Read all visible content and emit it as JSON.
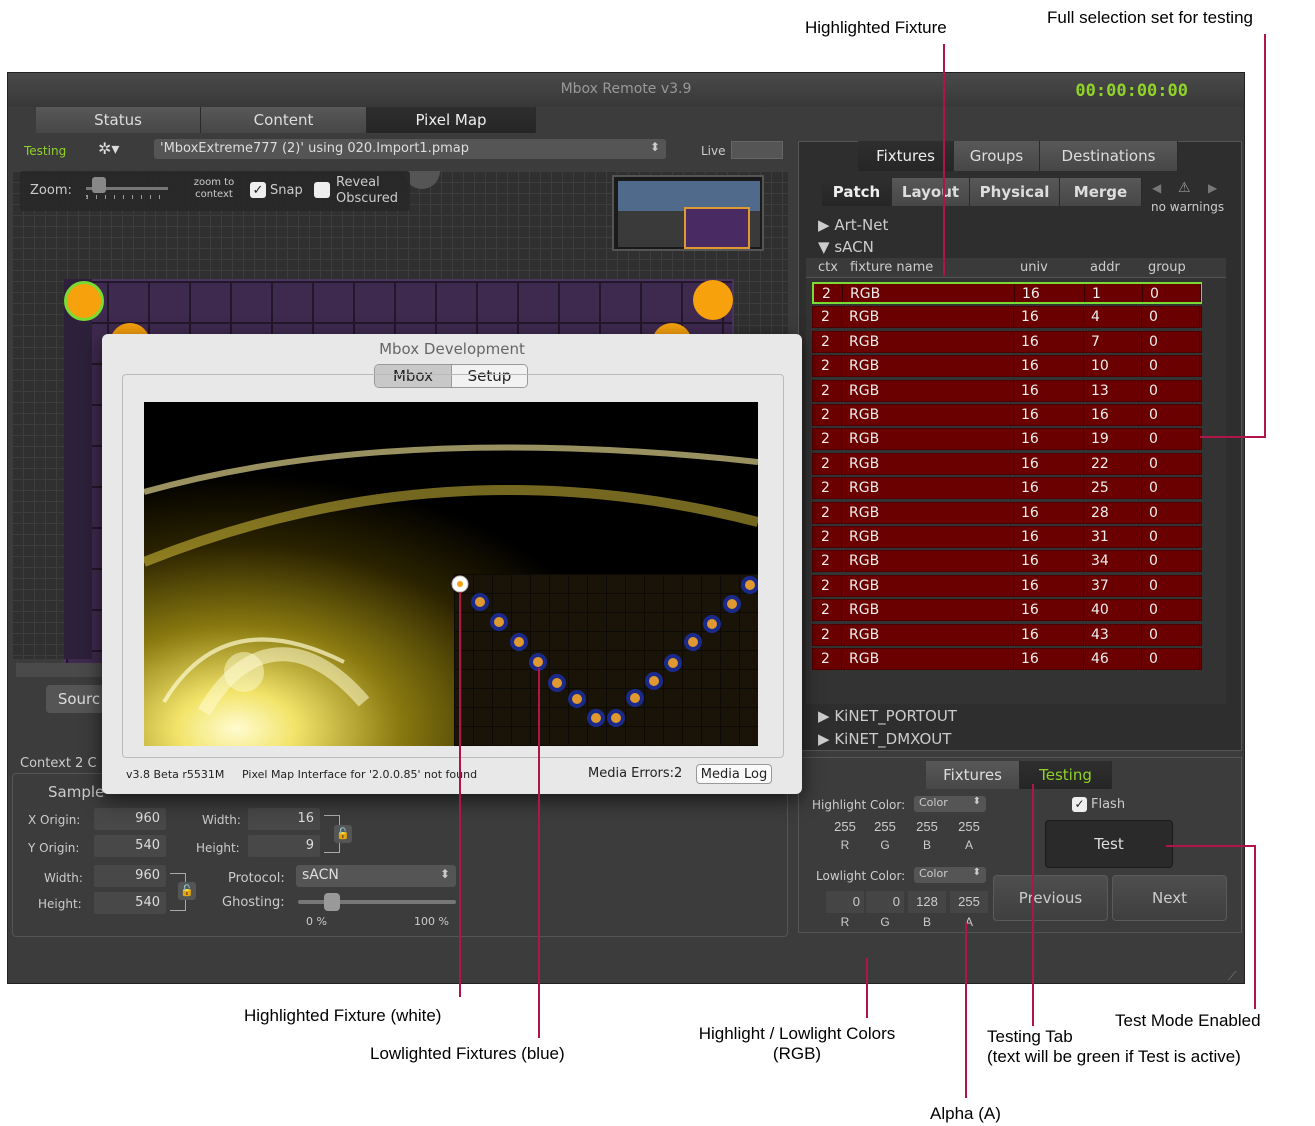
{
  "annotations": {
    "highlighted_fixture": "Highlighted Fixture",
    "full_selection": "Full selection set for testing",
    "highlighted_white": "Highlighted Fixture (white)",
    "lowlighted_blue": "Lowlighted Fixtures (blue)",
    "colors_line1": "Highlight / Lowlight Colors",
    "colors_line2": "(RGB)",
    "testing_tab_line1": "Testing Tab",
    "testing_tab_line2": "(text will be green if Test is active)",
    "test_mode": "Test Mode Enabled",
    "alpha": "Alpha (A)"
  },
  "window": {
    "title": "Mbox Remote v3.9",
    "timecode": "00:00:00:00",
    "tabs": [
      "Status",
      "Content",
      "Pixel Map"
    ],
    "active_tab": "Pixel Map"
  },
  "pixelmap": {
    "testing_label": "Testing",
    "file_select": "'MboxExtreme777 (2)' using 020.Import1.pmap",
    "live_label": "Live",
    "zoom_label": "Zoom:",
    "zoom_to_context": "zoom to context",
    "snap_label": "Snap",
    "snap_checked": true,
    "reveal_label": "Reveal Obscured",
    "reveal_checked": false,
    "source_button": "Sourc",
    "context_label": "Context 2 C",
    "sample_label": "Sample",
    "x_origin_label": "X Origin:",
    "x_origin": "960",
    "y_origin_label": "Y Origin:",
    "y_origin": "540",
    "width_label": "Width:",
    "width": "960",
    "height_label": "Height:",
    "height": "540",
    "sub_width_label": "Width:",
    "sub_width": "16",
    "sub_height_label": "Height:",
    "sub_height": "9",
    "protocol_label": "Protocol:",
    "protocol": "sACN",
    "ghosting_label": "Ghosting:",
    "ghost_min": "0 %",
    "ghost_max": "100 %"
  },
  "devwindow": {
    "title": "Mbox Development",
    "tabs": [
      "Mbox",
      "Setup"
    ],
    "version": "v3.8 Beta r5531M",
    "message": "Pixel Map Interface for '2.0.0.85' not found",
    "media_errors": "Media Errors:2",
    "media_log": "Media Log"
  },
  "right": {
    "top_tabs": [
      "Fixtures",
      "Groups",
      "Destinations"
    ],
    "sub_tabs": [
      "Patch",
      "Layout",
      "Physical",
      "Merge"
    ],
    "warnings": "no warnings",
    "tree": [
      "Art-Net",
      "sACN"
    ],
    "tree_bottom": [
      "KiNET_PORTOUT",
      "KiNET_DMXOUT"
    ],
    "columns": [
      "ctx",
      "fixture name",
      "univ",
      "addr",
      "group"
    ],
    "rows": [
      {
        "ctx": "2",
        "name": "RGB",
        "univ": "16",
        "addr": "1",
        "group": "0"
      },
      {
        "ctx": "2",
        "name": "RGB",
        "univ": "16",
        "addr": "4",
        "group": "0"
      },
      {
        "ctx": "2",
        "name": "RGB",
        "univ": "16",
        "addr": "7",
        "group": "0"
      },
      {
        "ctx": "2",
        "name": "RGB",
        "univ": "16",
        "addr": "10",
        "group": "0"
      },
      {
        "ctx": "2",
        "name": "RGB",
        "univ": "16",
        "addr": "13",
        "group": "0"
      },
      {
        "ctx": "2",
        "name": "RGB",
        "univ": "16",
        "addr": "16",
        "group": "0"
      },
      {
        "ctx": "2",
        "name": "RGB",
        "univ": "16",
        "addr": "19",
        "group": "0"
      },
      {
        "ctx": "2",
        "name": "RGB",
        "univ": "16",
        "addr": "22",
        "group": "0"
      },
      {
        "ctx": "2",
        "name": "RGB",
        "univ": "16",
        "addr": "25",
        "group": "0"
      },
      {
        "ctx": "2",
        "name": "RGB",
        "univ": "16",
        "addr": "28",
        "group": "0"
      },
      {
        "ctx": "2",
        "name": "RGB",
        "univ": "16",
        "addr": "31",
        "group": "0"
      },
      {
        "ctx": "2",
        "name": "RGB",
        "univ": "16",
        "addr": "34",
        "group": "0"
      },
      {
        "ctx": "2",
        "name": "RGB",
        "univ": "16",
        "addr": "37",
        "group": "0"
      },
      {
        "ctx": "2",
        "name": "RGB",
        "univ": "16",
        "addr": "40",
        "group": "0"
      },
      {
        "ctx": "2",
        "name": "RGB",
        "univ": "16",
        "addr": "43",
        "group": "0"
      },
      {
        "ctx": "2",
        "name": "RGB",
        "univ": "16",
        "addr": "46",
        "group": "0"
      }
    ],
    "bottom_tabs": [
      "Fixtures",
      "Testing"
    ],
    "highlight_label": "Highlight Color:",
    "lowlight_label": "Lowlight Color:",
    "color_select": "Color",
    "highlight_values": [
      "255",
      "255",
      "255",
      "255"
    ],
    "lowlight_values": [
      "0",
      "0",
      "128",
      "255"
    ],
    "channel_letters": [
      "R",
      "G",
      "B",
      "A"
    ],
    "flash_label": "Flash",
    "flash_checked": true,
    "test_button": "Test",
    "previous_button": "Previous",
    "next_button": "Next"
  },
  "colors": {
    "accent_green": "#8fd22a",
    "row_red": "#6b0000",
    "fixture_orange": "#f7a10d",
    "lowlight_blue": "#1a2a8a",
    "leader_line": "#b0154a"
  }
}
